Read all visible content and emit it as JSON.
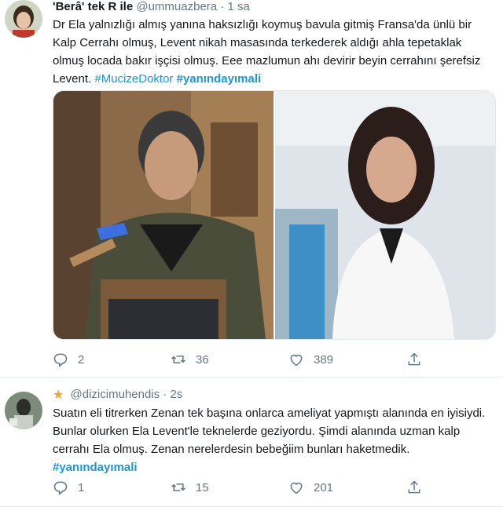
{
  "tweets": [
    {
      "display_name": "'Berâ' tek R ile",
      "handle": "@ummuazbera",
      "separator": "·",
      "time": "1 sa",
      "text": "Dr Ela yalnızlığı almış yanına haksızlığı koymuş bavula gitmiş Fransa'da ünlü bir Kalp Cerrahı olmuş, Levent nikah masasında terkederek aldığı ahla tepetaklak olmuş locada bakır işçisi olmuş. Eee mazlumun ahı devirir beyin cerrahını şerefsiz Levent.",
      "hashtag1": "#MucizeDoktor",
      "hashtag2": "#yanındayımali",
      "replies": "2",
      "retweets": "36",
      "likes": "389"
    },
    {
      "handle": "@dizicimuhendis",
      "separator": "·",
      "time": "2s",
      "text": "Suatın eli titrerken Zenan tek başına onlarca ameliyat yapmıştı alanında en iyisiydi. Bunlar olurken Ela Levent'le teknelerde geziyordu. Şimdi alanında uzman kalp cerrahı Ela olmuş. Zenan nerelerdesin bebeğiim bunları haketmedik.",
      "hashtag": "#yanındayımali",
      "replies": "1",
      "retweets": "15",
      "likes": "201"
    }
  ],
  "icons": {
    "reply": "reply-icon",
    "retweet": "retweet-icon",
    "like": "heart-icon",
    "share": "share-icon",
    "star": "star-icon"
  },
  "colors": {
    "link": "#1b95e0",
    "muted": "#657786",
    "divider": "#e6ecf0",
    "star": "#f5a623"
  }
}
